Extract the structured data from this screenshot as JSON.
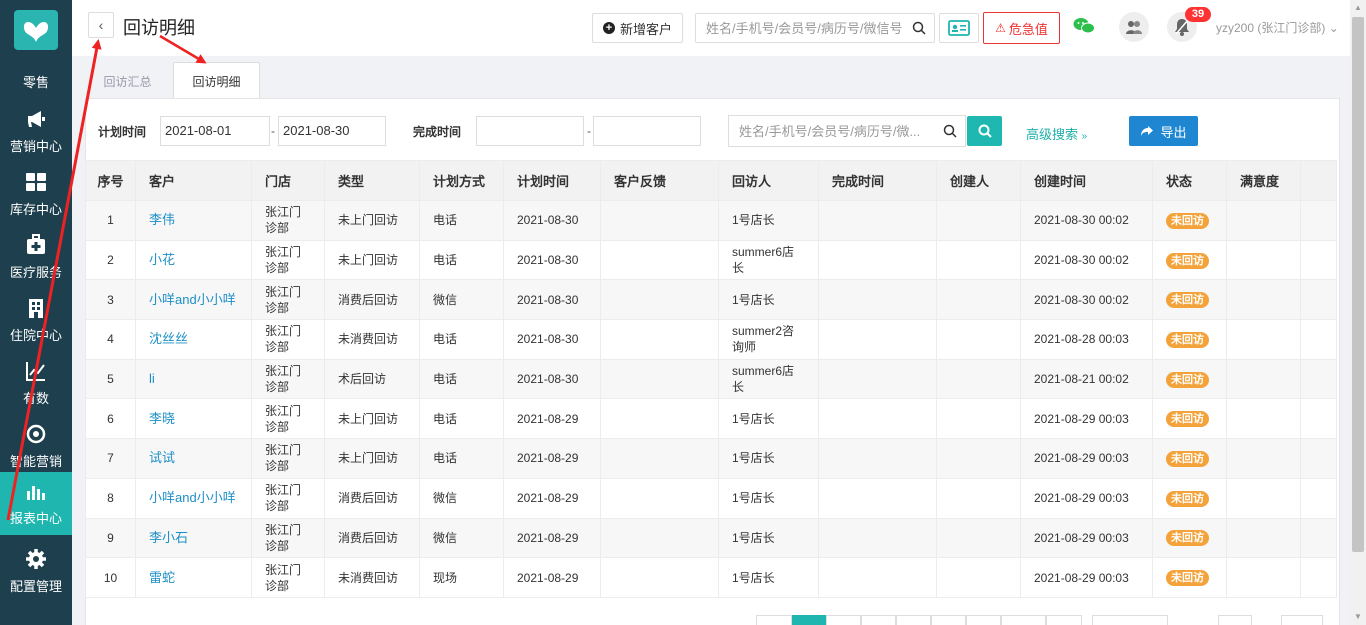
{
  "sidebar": {
    "logo": "butterfly-logo",
    "items": [
      {
        "label": "零售",
        "icon": "retail-icon"
      },
      {
        "label": "营销中心",
        "icon": "megaphone-icon"
      },
      {
        "label": "库存中心",
        "icon": "grid-icon"
      },
      {
        "label": "医疗服务",
        "icon": "medical-kit-icon"
      },
      {
        "label": "住院中心",
        "icon": "building-icon"
      },
      {
        "label": "有数",
        "icon": "line-chart-icon"
      },
      {
        "label": "智能营销",
        "icon": "smart-marketing-icon"
      },
      {
        "label": "报表中心",
        "icon": "bar-chart-icon",
        "active": true
      },
      {
        "label": "配置管理",
        "icon": "gear-icon"
      }
    ]
  },
  "header": {
    "title": "回访明细",
    "new_customer": "新增客户",
    "search_placeholder": "姓名/手机号/会员号/病历号/微信号",
    "danger_label": "危急值",
    "badge_count": "39",
    "user": "yzy200 (张江门诊部)"
  },
  "tabs": [
    {
      "label": "回访汇总",
      "active": false
    },
    {
      "label": "回访明细",
      "active": true
    }
  ],
  "filters": {
    "plan_time_label": "计划时间",
    "plan_start": "2021-08-01",
    "plan_end": "2021-08-30",
    "done_time_label": "完成时间",
    "done_start": "",
    "done_end": "",
    "dash": "-",
    "search_placeholder": "姓名/手机号/会员号/病历号/微...",
    "advanced": "高级搜索",
    "export": "导出"
  },
  "table": {
    "columns": [
      "序号",
      "客户",
      "门店",
      "类型",
      "计划方式",
      "计划时间",
      "客户反馈",
      "回访人",
      "完成时间",
      "创建人",
      "创建时间",
      "状态",
      "满意度"
    ],
    "rows": [
      {
        "idx": "1",
        "customer": "李伟",
        "store": "张江门诊部",
        "type": "未上门回访",
        "method": "电话",
        "plan_time": "2021-08-30",
        "feedback": "",
        "visitor": "1号店长",
        "done_time": "",
        "creator": "",
        "created": "2021-08-30 00:02",
        "status": "未回访",
        "satisfaction": ""
      },
      {
        "idx": "2",
        "customer": "小花",
        "store": "张江门诊部",
        "type": "未上门回访",
        "method": "电话",
        "plan_time": "2021-08-30",
        "feedback": "",
        "visitor": "summer6店长",
        "done_time": "",
        "creator": "",
        "created": "2021-08-30 00:02",
        "status": "未回访",
        "satisfaction": ""
      },
      {
        "idx": "3",
        "customer": "小咩and小小咩",
        "store": "张江门诊部",
        "type": "消费后回访",
        "method": "微信",
        "plan_time": "2021-08-30",
        "feedback": "",
        "visitor": "1号店长",
        "done_time": "",
        "creator": "",
        "created": "2021-08-30 00:02",
        "status": "未回访",
        "satisfaction": ""
      },
      {
        "idx": "4",
        "customer": "沈丝丝",
        "store": "张江门诊部",
        "type": "未消费回访",
        "method": "电话",
        "plan_time": "2021-08-30",
        "feedback": "",
        "visitor": "summer2咨询师",
        "done_time": "",
        "creator": "",
        "created": "2021-08-28 00:03",
        "status": "未回访",
        "satisfaction": ""
      },
      {
        "idx": "5",
        "customer": "li",
        "store": "张江门诊部",
        "type": "术后回访",
        "method": "电话",
        "plan_time": "2021-08-30",
        "feedback": "",
        "visitor": "summer6店长",
        "done_time": "",
        "creator": "",
        "created": "2021-08-21 00:02",
        "status": "未回访",
        "satisfaction": ""
      },
      {
        "idx": "6",
        "customer": "李晓",
        "store": "张江门诊部",
        "type": "未上门回访",
        "method": "电话",
        "plan_time": "2021-08-29",
        "feedback": "",
        "visitor": "1号店长",
        "done_time": "",
        "creator": "",
        "created": "2021-08-29 00:03",
        "status": "未回访",
        "satisfaction": ""
      },
      {
        "idx": "7",
        "customer": "试试",
        "store": "张江门诊部",
        "type": "未上门回访",
        "method": "电话",
        "plan_time": "2021-08-29",
        "feedback": "",
        "visitor": "1号店长",
        "done_time": "",
        "creator": "",
        "created": "2021-08-29 00:03",
        "status": "未回访",
        "satisfaction": ""
      },
      {
        "idx": "8",
        "customer": "小咩and小小咩",
        "store": "张江门诊部",
        "type": "消费后回访",
        "method": "微信",
        "plan_time": "2021-08-29",
        "feedback": "",
        "visitor": "1号店长",
        "done_time": "",
        "creator": "",
        "created": "2021-08-29 00:03",
        "status": "未回访",
        "satisfaction": ""
      },
      {
        "idx": "9",
        "customer": "李小石",
        "store": "张江门诊部",
        "type": "消费后回访",
        "method": "微信",
        "plan_time": "2021-08-29",
        "feedback": "",
        "visitor": "1号店长",
        "done_time": "",
        "creator": "",
        "created": "2021-08-29 00:03",
        "status": "未回访",
        "satisfaction": ""
      },
      {
        "idx": "10",
        "customer": "雷蛇",
        "store": "张江门诊部",
        "type": "未消费回访",
        "method": "现场",
        "plan_time": "2021-08-29",
        "feedback": "",
        "visitor": "1号店长",
        "done_time": "",
        "creator": "",
        "created": "2021-08-29 00:03",
        "status": "未回访",
        "satisfaction": ""
      }
    ]
  },
  "colors": {
    "sidebar_bg": "#1e3f4d",
    "accent": "#1fb6b0",
    "link": "#1e8fc6",
    "status_tag": "#f3a33a",
    "danger": "#e33333",
    "export_btn": "#1f87d1",
    "annotation": "#ee2222"
  }
}
